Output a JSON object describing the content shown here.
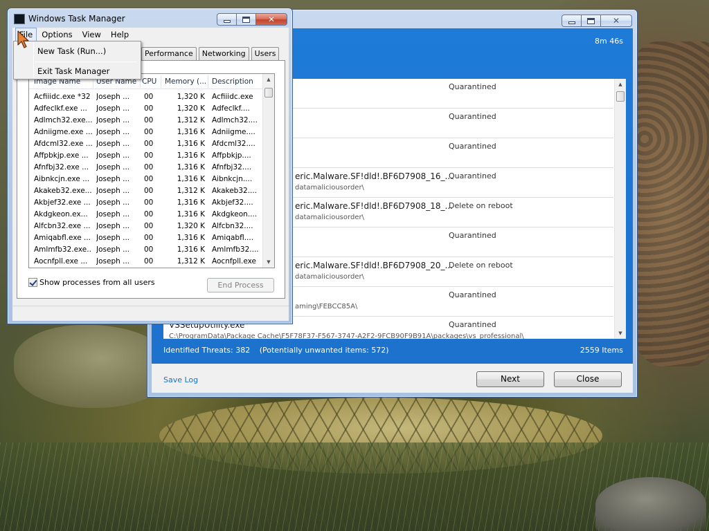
{
  "scan_window": {
    "elapsed": "8m 46s",
    "results": [
      {
        "name": "",
        "path": "",
        "action": "Quarantined"
      },
      {
        "name": "",
        "path": "",
        "action": "Quarantined"
      },
      {
        "name": "",
        "path": "",
        "action": "Quarantined"
      },
      {
        "name": "eric.Malware.SF!dld!.BF6D7908_16_...",
        "path": "datamaliciousorder\\",
        "action": "Quarantined"
      },
      {
        "name": "eric.Malware.SF!dld!.BF6D7908_18_...",
        "path": "datamaliciousorder\\",
        "action": "Delete on reboot"
      },
      {
        "name": "",
        "path": "",
        "action": "Quarantined"
      },
      {
        "name": "eric.Malware.SF!dld!.BF6D7908_20_...",
        "path": "datamaliciousorder\\",
        "action": "Delete on reboot"
      },
      {
        "name": "",
        "path": "aming\\FEBCC85A\\",
        "action": "Quarantined"
      },
      {
        "name": "VSSetupUtility.exe",
        "path": "C:\\ProgramData\\Package Cache\\F5F78F37-F567-3747-A2F2-9FCB90F9B91A\\packages\\vs_professional\\",
        "action": "Quarantined"
      }
    ],
    "status": {
      "threats": "Identified Threats: 382",
      "pup": "(Potentially unwanted items: 572)",
      "items": "2559 Items"
    },
    "save_log": "Save Log",
    "next_label": "Next",
    "close_label": "Close"
  },
  "taskmgr": {
    "title": "Windows Task Manager",
    "menu": [
      "File",
      "Options",
      "View",
      "Help"
    ],
    "file_menu": [
      "New Task (Run...)",
      "Exit Task Manager"
    ],
    "tabs": [
      "Performance",
      "Networking",
      "Users"
    ],
    "columns": [
      "Image Name",
      "User Name",
      "CPU",
      "Memory (...",
      "Description"
    ],
    "processes": [
      {
        "image": "Acfiiidc.exe *32",
        "user": "Joseph ...",
        "cpu": "00",
        "mem": "1,320 K",
        "desc": "Acfiiidc.exe"
      },
      {
        "image": "Adfeclkf.exe ...",
        "user": "Joseph ...",
        "cpu": "00",
        "mem": "1,320 K",
        "desc": "Adfeclkf...."
      },
      {
        "image": "Adlmch32.exe...",
        "user": "Joseph ...",
        "cpu": "00",
        "mem": "1,312 K",
        "desc": "Adlmch32...."
      },
      {
        "image": "Adniigme.exe ...",
        "user": "Joseph ...",
        "cpu": "00",
        "mem": "1,316 K",
        "desc": "Adniigme...."
      },
      {
        "image": "Afdcml32.exe ...",
        "user": "Joseph ...",
        "cpu": "00",
        "mem": "1,316 K",
        "desc": "Afdcml32...."
      },
      {
        "image": "Affpbkjp.exe ...",
        "user": "Joseph ...",
        "cpu": "00",
        "mem": "1,316 K",
        "desc": "Affpbkjp...."
      },
      {
        "image": "Afnfbj32.exe ...",
        "user": "Joseph ...",
        "cpu": "00",
        "mem": "1,316 K",
        "desc": "Afnfbj32...."
      },
      {
        "image": "Aibnkcjn.exe ...",
        "user": "Joseph ...",
        "cpu": "00",
        "mem": "1,316 K",
        "desc": "Aibnkcjn...."
      },
      {
        "image": "Akakeb32.exe...",
        "user": "Joseph ...",
        "cpu": "00",
        "mem": "1,312 K",
        "desc": "Akakeb32...."
      },
      {
        "image": "Akbjef32.exe ...",
        "user": "Joseph ...",
        "cpu": "00",
        "mem": "1,316 K",
        "desc": "Akbjef32...."
      },
      {
        "image": "Akdgkeon.ex...",
        "user": "Joseph ...",
        "cpu": "00",
        "mem": "1,316 K",
        "desc": "Akdgkeon...."
      },
      {
        "image": "Alfcbn32.exe ...",
        "user": "Joseph ...",
        "cpu": "00",
        "mem": "1,320 K",
        "desc": "Alfcbn32...."
      },
      {
        "image": "Amiqabfl.exe ...",
        "user": "Joseph ...",
        "cpu": "00",
        "mem": "1,316 K",
        "desc": "Amiqabfl...."
      },
      {
        "image": "Amlmfb32.exe...",
        "user": "Joseph ...",
        "cpu": "00",
        "mem": "1,316 K",
        "desc": "Amlmfb32...."
      },
      {
        "image": "Aocnfpll.exe ...",
        "user": "Joseph ...",
        "cpu": "00",
        "mem": "1,312 K",
        "desc": "Aocnfpll.exe"
      }
    ],
    "show_all": "Show processes from all users",
    "end_process": "End Process"
  }
}
